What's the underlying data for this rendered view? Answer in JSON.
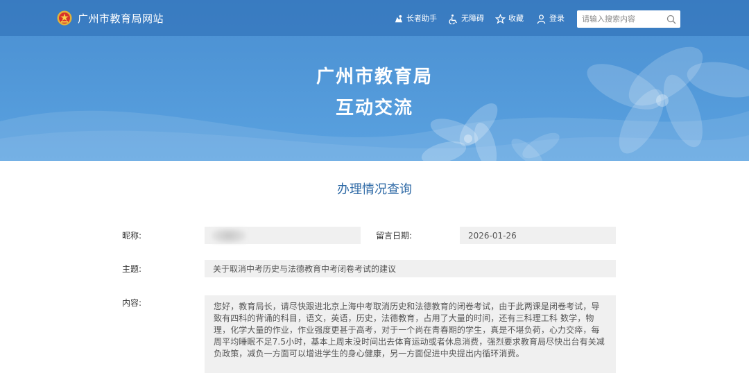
{
  "header": {
    "site_name": "广州市教育局网站",
    "tools": [
      {
        "label": "长者助手",
        "icon": "elder-helper-icon"
      },
      {
        "label": "无障碍",
        "icon": "accessibility-icon"
      },
      {
        "label": "收藏",
        "icon": "star-icon"
      },
      {
        "label": "登录",
        "icon": "user-icon"
      }
    ],
    "search": {
      "placeholder": "请输入搜索内容",
      "value": ""
    }
  },
  "banner": {
    "title_line1": "广州市教育局",
    "title_line2": "互动交流"
  },
  "section_title": "办理情况查询",
  "form": {
    "nickname_label": "昵称:",
    "nickname_value": "",
    "date_label": "留言日期:",
    "date_value": "2026-01-26",
    "subject_label": "主题:",
    "subject_value": "关于取消中考历史与法德教育中考闭卷考试的建议",
    "content_label": "内容:",
    "content_value": "您好，教育局长，请尽快跟进北京上海中考取消历史和法德教育的闭卷考试，由于此两课是闭卷考试，导致有四科的背诵的科目，语文，英语，历史，法德教育，占用了大量的时间，还有三科理工科 数学，物理，化学大量的作业，作业强度更甚于高考，对于一个尚在青春期的学生，真是不堪负荷，心力交瘁，每周平均睡眠不足7.5小时，基本上周末没时间出去体育运动或者休息消费，强烈要求教育局尽快出台有关减负政策，减负一方面可以增进学生的身心健康，另一方面促进中央提出内循环消费。"
  },
  "colors": {
    "banner": "#4f95d6",
    "topbar": "#2b6cb2",
    "section_title": "#2f6aa6",
    "field_bg": "#f0f0f0"
  }
}
